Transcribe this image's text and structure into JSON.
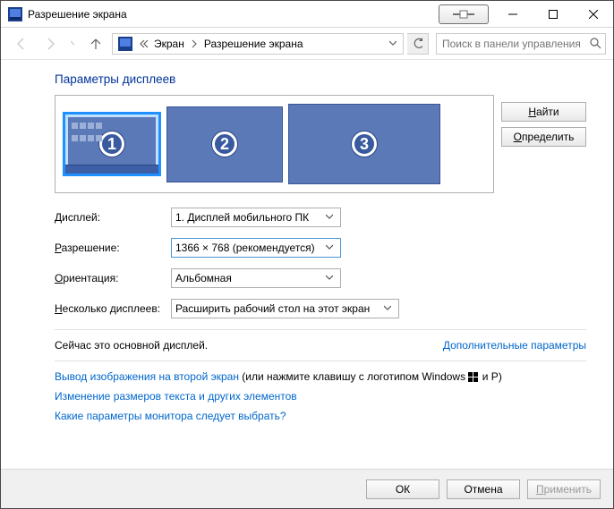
{
  "window": {
    "title": "Разрешение экрана"
  },
  "breadcrumbs": {
    "item1": "Экран",
    "item2": "Разрешение экрана"
  },
  "search": {
    "placeholder": "Поиск в панели управления"
  },
  "heading": "Параметры дисплеев",
  "monitor_badges": {
    "m1": "1",
    "m2": "2",
    "m3": "3"
  },
  "side_buttons": {
    "find_prefix": "Н",
    "find_rest": "айти",
    "identify_prefix": "О",
    "identify_rest": "пределить"
  },
  "form": {
    "display_label_prefix": "Д",
    "display_label_rest": "исплей:",
    "display_value": "1. Дисплей мобильного ПК",
    "resolution_label_prefix": "Р",
    "resolution_label_rest": "азрешение:",
    "resolution_value": "1366 × 768 (рекомендуется)",
    "orientation_label_prefix": "О",
    "orientation_label_rest": "риентация:",
    "orientation_value": "Альбомная",
    "multi_label_prefix": "Н",
    "multi_label_rest": "есколько дисплеев:",
    "multi_value": "Расширить рабочий стол на этот экран"
  },
  "status": {
    "primary_text": "Сейчас это основной дисплей.",
    "advanced_link": "Дополнительные параметры"
  },
  "links": {
    "project_link": "Вывод изображения на второй экран",
    "project_suffix": " (или нажмите клавишу с логотипом Windows ",
    "project_tail": " и P)",
    "resize_link": "Изменение размеров текста и других элементов",
    "which_link": "Какие параметры монитора следует выбрать?"
  },
  "footer": {
    "ok": "ОК",
    "cancel": "Отмена",
    "apply_prefix": "П",
    "apply_rest": "рименить"
  }
}
